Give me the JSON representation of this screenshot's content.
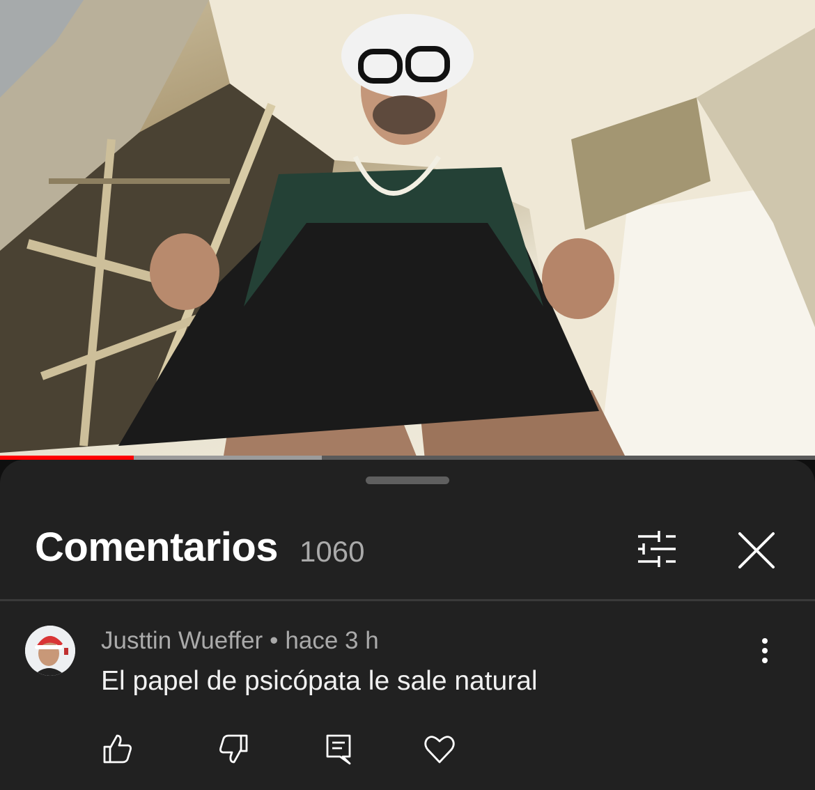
{
  "video": {
    "progress_played": 0.164,
    "progress_buffered": 0.395
  },
  "comments_panel": {
    "title": "Comentarios",
    "count": "1060",
    "filter_icon": "filter-sliders-icon",
    "close_icon": "close-icon"
  },
  "comment": {
    "author": "Justtin Wueffer",
    "separator": "•",
    "time": "hace 3 h",
    "text": "El papel de psicópata le sale natural",
    "actions": [
      "like-icon",
      "dislike-icon",
      "reply-icon",
      "heart-icon"
    ]
  },
  "colors": {
    "background": "#0f0f0f",
    "sheet": "#212121",
    "progress_played": "#ff0000",
    "text_primary": "#ffffff",
    "text_secondary": "#aaaaaa"
  }
}
